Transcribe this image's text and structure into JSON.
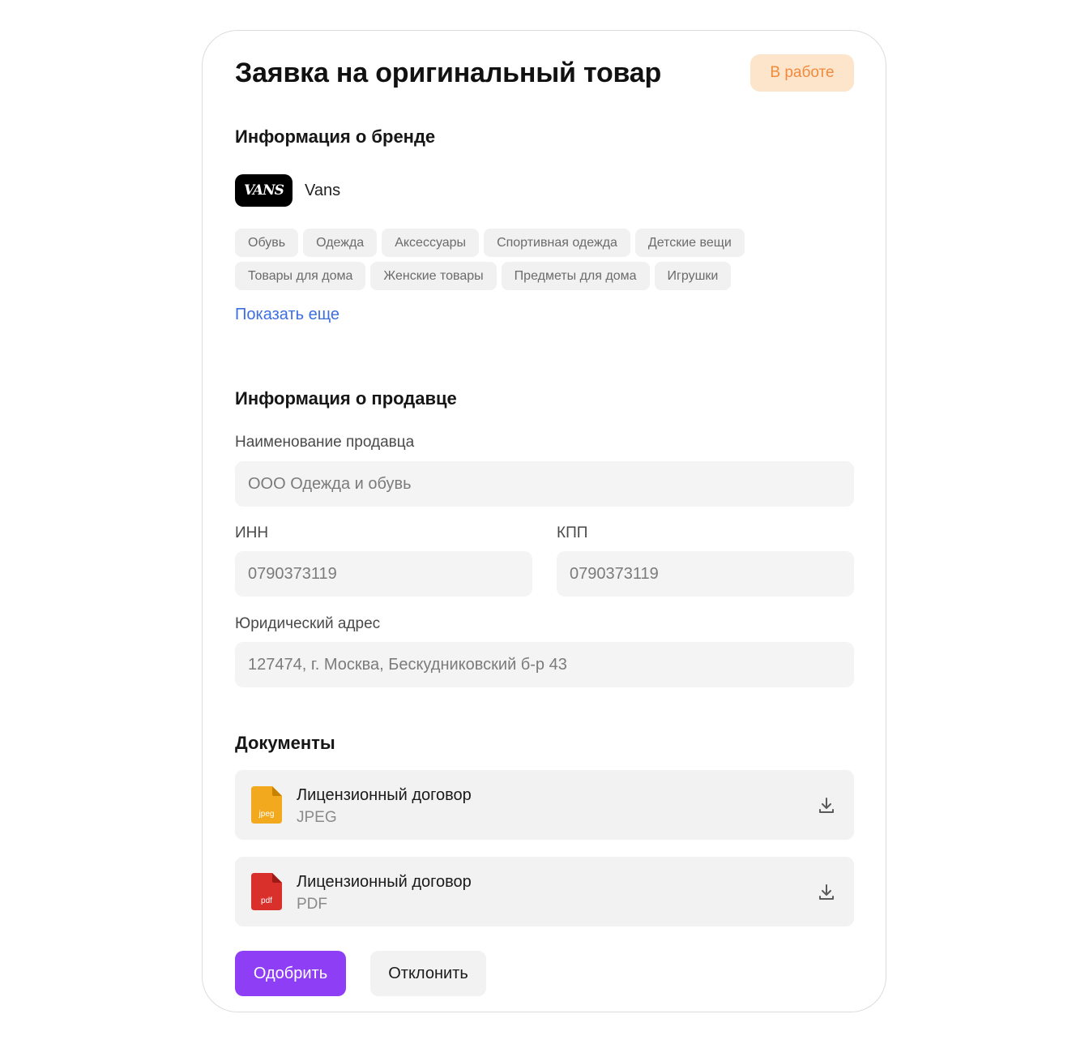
{
  "header": {
    "title": "Заявка на оригинальный товар",
    "status": "В работе"
  },
  "brand_section": {
    "title": "Информация о бренде",
    "logo_text": "VANS",
    "brand_name": "Vans",
    "categories": [
      "Обувь",
      "Одежда",
      "Аксессуары",
      "Спортивная одежда",
      "Детские вещи",
      "Товары для дома",
      "Женские товары",
      "Предметы для дома",
      "Игрушки"
    ],
    "show_more": "Показать еще"
  },
  "seller_section": {
    "title": "Информация о продавце",
    "name_label": "Наименование продавца",
    "name_value": "ООО Одежда и обувь",
    "inn_label": "ИНН",
    "inn_value": "0790373119",
    "kpp_label": "КПП",
    "kpp_value": "0790373119",
    "address_label": "Юридический адрес",
    "address_value": "127474, г. Москва, Бескудниковский б-р 43"
  },
  "documents_section": {
    "title": "Документы",
    "items": [
      {
        "name": "Лицензионный договор",
        "type": "JPEG",
        "icon_label": "jpeg",
        "icon": "jpeg-file-icon",
        "color": "#f2a91e"
      },
      {
        "name": "Лицензионный договор",
        "type": "PDF",
        "icon_label": "pdf",
        "icon": "pdf-file-icon",
        "color": "#d9302b"
      }
    ]
  },
  "actions": {
    "approve": "Одобрить",
    "reject": "Отклонить"
  },
  "colors": {
    "accent": "#8e3ff5",
    "status_bg": "#fde5cc",
    "status_text": "#f28a3c",
    "link": "#3d6fe0"
  }
}
